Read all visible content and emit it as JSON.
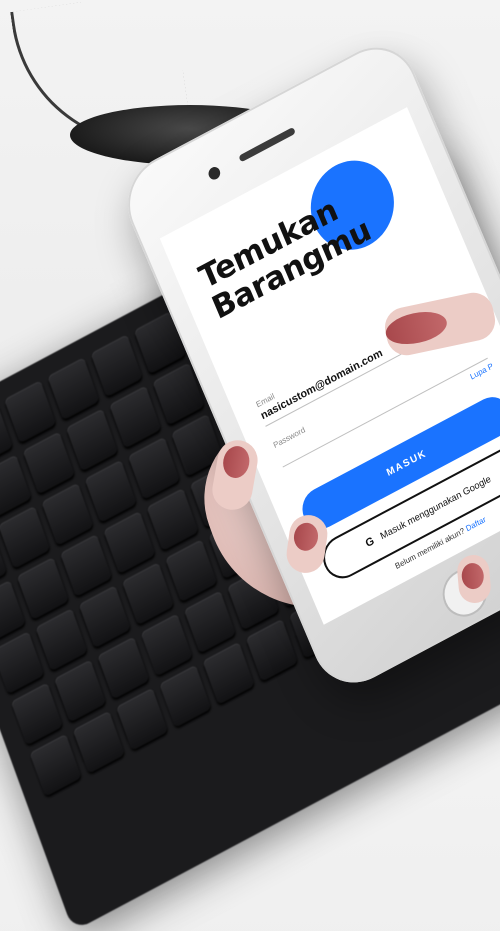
{
  "app": {
    "title_line1": "Temukan",
    "title_line2": "Barangmu"
  },
  "login": {
    "email_label": "Email",
    "email_value": "nasicustom@domain.com",
    "password_label": "Password",
    "password_value": "",
    "forgot_link": "Lupa P",
    "submit_label": "MASUK",
    "google_label": "Masuk menggunakan Google",
    "google_icon": "G",
    "signup_prompt": "Belum memiliki akun?",
    "signup_link": "Daftar"
  },
  "colors": {
    "accent": "#1a73ff",
    "text": "#111111",
    "screen_bg": "#ffffff"
  }
}
